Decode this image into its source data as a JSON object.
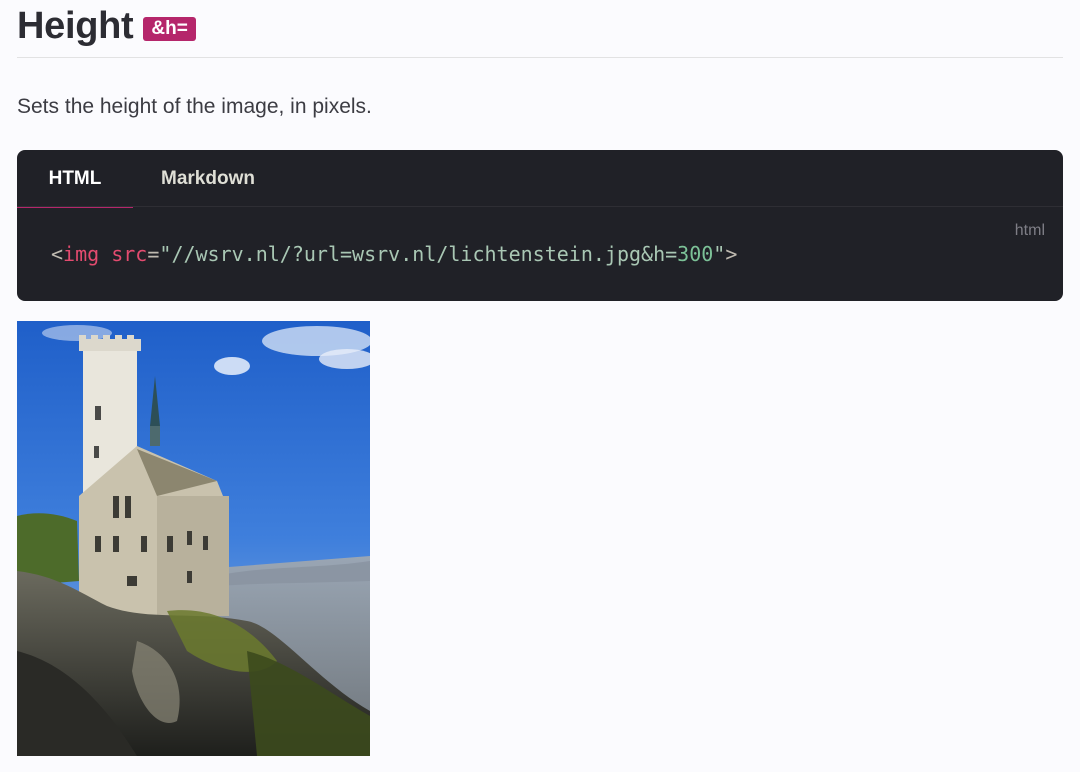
{
  "section": {
    "title": "Height",
    "param_badge": "&h=",
    "description": "Sets the height of the image, in pixels."
  },
  "code_block": {
    "tabs": [
      {
        "label": "HTML",
        "active": true
      },
      {
        "label": "Markdown",
        "active": false
      }
    ],
    "language": "html",
    "tokens": {
      "open": "<",
      "tag": "img",
      "space": " ",
      "attr": "src",
      "eq": "=",
      "quote_open": "\"",
      "value_main": "//wsrv.nl/?url=wsrv.nl/lichtenstein.jpg&h=",
      "value_end": "300",
      "quote_close": "\"",
      "close": ">"
    }
  },
  "colors": {
    "accent": "#b5266b",
    "code_bg": "#202127",
    "page_bg": "#fbfbfe"
  }
}
